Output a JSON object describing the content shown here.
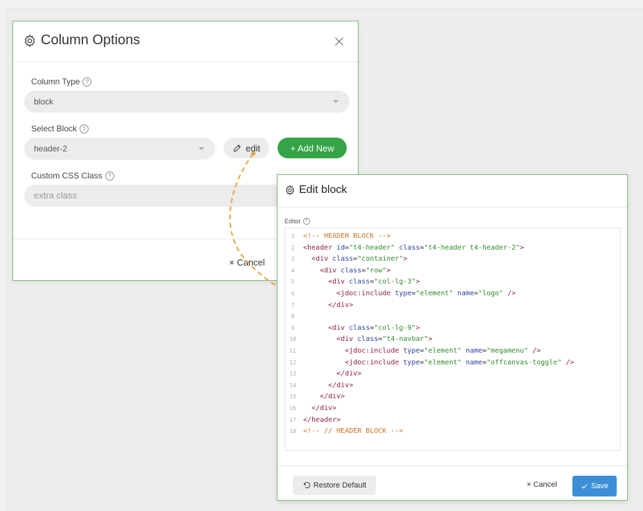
{
  "column_options": {
    "title": "Column Options",
    "column_type": {
      "label": "Column Type",
      "value": "block"
    },
    "select_block": {
      "label": "Select Block",
      "value": "header-2"
    },
    "edit_label": "edit",
    "add_new_label": "+ Add New",
    "custom_css": {
      "label": "Custom CSS Class",
      "placeholder": "extra class"
    },
    "cancel_label": "× Cancel"
  },
  "edit_block": {
    "title": "Edit block",
    "editor_label": "Editor",
    "code_lines": [
      {
        "n": "1",
        "text": "<!-- HEADER BLOCK -->"
      },
      {
        "n": "2",
        "text": "<header id=\"t4-header\" class=\"t4-header t4-header-2\">"
      },
      {
        "n": "3",
        "text": "  <div class=\"container\">"
      },
      {
        "n": "4",
        "text": "    <div class=\"row\">"
      },
      {
        "n": "5",
        "text": "      <div class=\"col-lg-3\">"
      },
      {
        "n": "6",
        "text": "        <jdoc:include type=\"element\" name=\"logo\" />"
      },
      {
        "n": "7",
        "text": "      </div>"
      },
      {
        "n": "8",
        "text": ""
      },
      {
        "n": "9",
        "text": "      <div class=\"col-lg-9\">"
      },
      {
        "n": "10",
        "text": "        <div class=\"t4-navbar\">"
      },
      {
        "n": "11",
        "text": "          <jdoc:include type=\"element\" name=\"megamenu\" />"
      },
      {
        "n": "12",
        "text": "          <jdoc:include type=\"element\" name=\"offcanvas-toggle\" />"
      },
      {
        "n": "13",
        "text": "        </div>"
      },
      {
        "n": "14",
        "text": "      </div>"
      },
      {
        "n": "15",
        "text": "    </div>"
      },
      {
        "n": "16",
        "text": "  </div>"
      },
      {
        "n": "17",
        "text": "</header>"
      },
      {
        "n": "18",
        "text": "<!-- // HEADER BLOCK -->"
      }
    ],
    "restore_label": "Restore Default",
    "cancel_label": "× Cancel",
    "save_label": "Save"
  },
  "colors": {
    "dialog_border": "#7fb87a",
    "add_new_green": "#35a447",
    "save_blue": "#3c8fd6",
    "arrow_orange": "#e8a13a"
  }
}
